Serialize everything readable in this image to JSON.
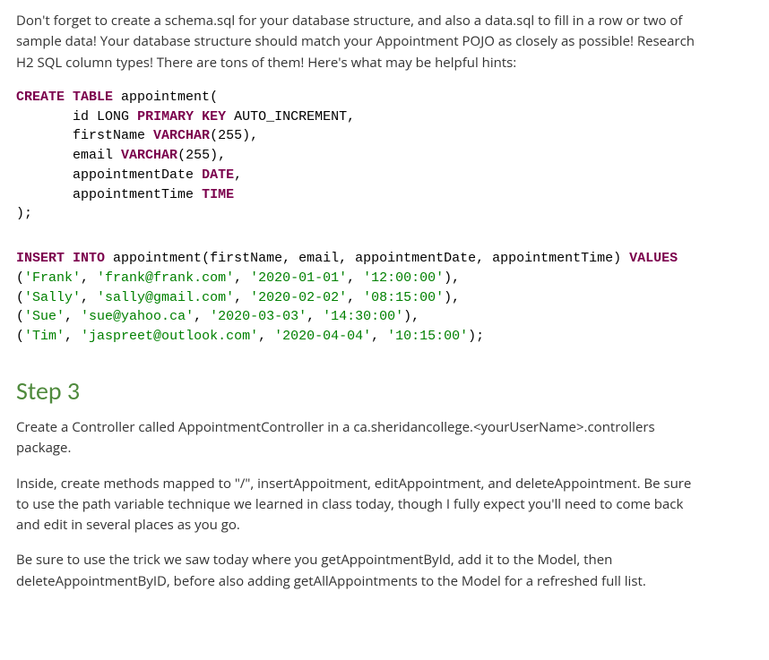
{
  "intro": {
    "paragraph": "Don't forget to create a schema.sql for your database structure, and also a data.sql to fill in a row or two of sample data!  Your database structure should match your Appointment POJO as closely as possible!  Research H2 SQL column types!  There are tons of them!  Here's what may be helpful hints:"
  },
  "schema_sql": {
    "kw_create_table": "CREATE TABLE",
    "table_name": "appointment",
    "open_paren": "(",
    "col_id": {
      "name": "id",
      "type": "LONG",
      "kw_pk": "PRIMARY KEY",
      "auto": "AUTO_INCREMENT"
    },
    "col_firstName": {
      "name": "firstName",
      "kw_type": "VARCHAR",
      "size": "255"
    },
    "col_email": {
      "name": "email",
      "kw_type": "VARCHAR",
      "size": "255"
    },
    "col_apptDate": {
      "name": "appointmentDate",
      "kw_type": "DATE"
    },
    "col_apptTime": {
      "name": "appointmentTime",
      "kw_type": "TIME"
    },
    "close": ");"
  },
  "data_sql": {
    "kw_insert_into": "INSERT INTO",
    "table_name": "appointment",
    "columns_raw": "(firstName, email, appointmentDate, appointmentTime)",
    "kw_values": "VALUES",
    "rows": [
      {
        "open": "(",
        "v0": "'Frank'",
        "c0": ", ",
        "v1": "'frank@frank.com'",
        "c1": ", ",
        "v2": "'2020-01-01'",
        "c2": ", ",
        "v3": "'12:00:00'",
        "close": "),"
      },
      {
        "open": "(",
        "v0": "'Sally'",
        "c0": ", ",
        "v1": "'sally@gmail.com'",
        "c1": ", ",
        "v2": "'2020-02-02'",
        "c2": ", ",
        "v3": "'08:15:00'",
        "close": "),"
      },
      {
        "open": "(",
        "v0": "'Sue'",
        "c0": ", ",
        "v1": "'sue@yahoo.ca'",
        "c1": ", ",
        "v2": "'2020-03-03'",
        "c2": ", ",
        "v3": "'14:30:00'",
        "close": "),"
      },
      {
        "open": "(",
        "v0": "'Tim'",
        "c0": ", ",
        "v1": "'jaspreet@outlook.com'",
        "c1": ", ",
        "v2": "'2020-04-04'",
        "c2": ", ",
        "v3": "'10:15:00'",
        "close": ");"
      }
    ]
  },
  "step3": {
    "heading": "Step 3",
    "p1": "Create a Controller called AppointmentController in a ca.sheridancollege.<yourUserName>.controllers package.",
    "p2": "Inside, create methods mapped to \"/\", insertAppoitment, editAppointment, and deleteAppointment.  Be sure to use the path variable technique we learned in class today, though I fully expect you'll need to come back and edit in several places as you go.",
    "p3": "Be sure to use the trick we saw today where you getAppointmentById, add it to the Model, then deleteAppointmentByID, before also adding getAllAppointments to the Model for a refreshed full list."
  }
}
